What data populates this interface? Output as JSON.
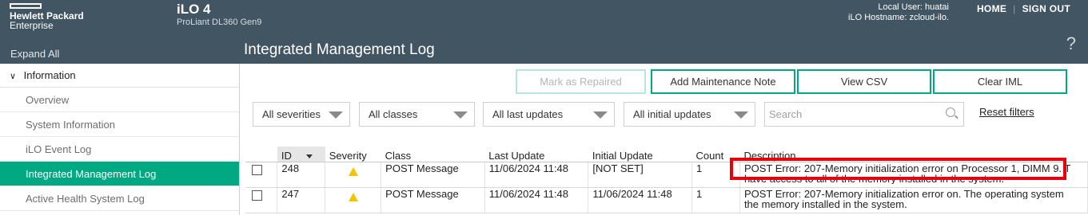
{
  "header": {
    "brand_line1": "Hewlett Packard",
    "brand_line2": "Enterprise",
    "product": "iLO 4",
    "model": "ProLiant DL360 Gen9",
    "local_user": "Local User: huatai",
    "hostname": "iLO Hostname: zcloud-ilo.",
    "home": "HOME",
    "sign_out": "SIGN OUT"
  },
  "subbar": {
    "expand_all": "Expand All",
    "page_title": "Integrated Management Log",
    "help": "?"
  },
  "sidebar": {
    "section": "Information",
    "items": [
      {
        "label": "Overview"
      },
      {
        "label": "System Information"
      },
      {
        "label": "iLO Event Log"
      },
      {
        "label": "Integrated Management Log",
        "active": true
      },
      {
        "label": "Active Health System Log"
      }
    ]
  },
  "toolbar": {
    "mark_repaired": "Mark as Repaired",
    "add_note": "Add Maintenance Note",
    "view_csv": "View CSV",
    "clear_iml": "Clear IML"
  },
  "filters": {
    "severities": "All severities",
    "classes": "All classes",
    "last_updates": "All last updates",
    "initial_updates": "All initial updates",
    "search_placeholder": "Search",
    "reset": "Reset filters"
  },
  "table": {
    "columns": [
      "ID",
      "Severity",
      "Class",
      "Last Update",
      "Initial Update",
      "Count",
      "Description"
    ],
    "rows": [
      {
        "id": "248",
        "severity": "warning",
        "class": "POST Message",
        "last_update": "11/06/2024 11:48",
        "initial_update": "[NOT SET]",
        "count": "1",
        "desc1": "POST Error: 207-Memory initialization error on Processor 1, DIMM 9. T",
        "desc2": "have access to all of the memory installed in the system."
      },
      {
        "id": "247",
        "severity": "warning",
        "class": "POST Message",
        "last_update": "11/06/2024 11:48",
        "initial_update": "11/06/2024 11:48",
        "count": "1",
        "desc1": "POST Error: 207-Memory initialization error on. The operating system",
        "desc2": "the memory installed in the system."
      }
    ]
  },
  "colors": {
    "header_bg": "#425563",
    "accent": "#01a982",
    "highlight": "#e8000b",
    "warning": "#f5c400"
  }
}
